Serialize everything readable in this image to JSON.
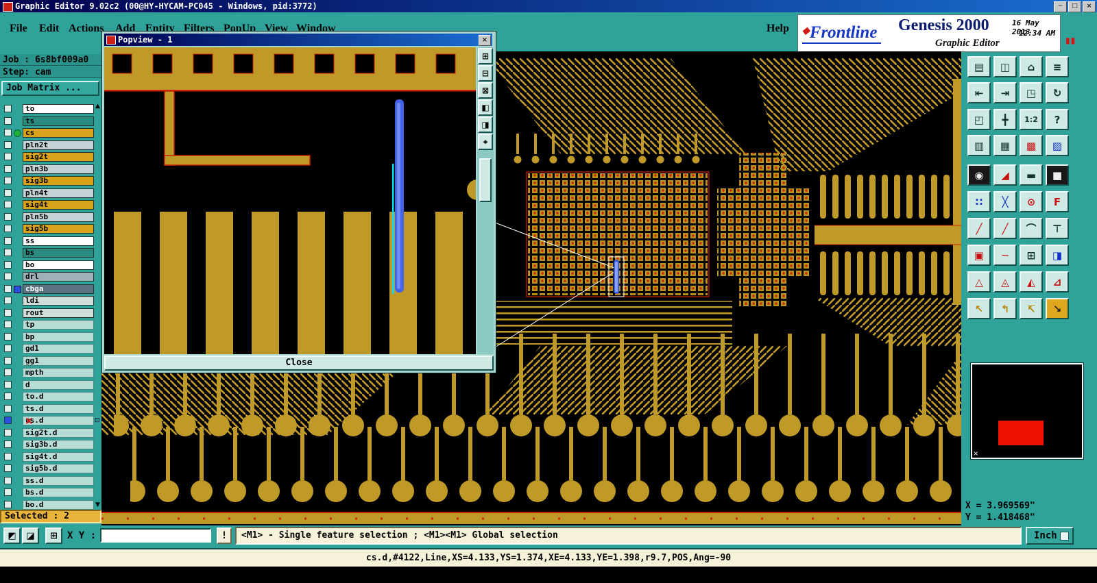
{
  "titlebar": {
    "title": "Graphic Editor 9.02c2 (00@HY-HYCAM-PC045 - Windows, pid:3772)"
  },
  "icons": {
    "minimize": "─",
    "maximize": "□",
    "close": "×",
    "scroll_up": "▲",
    "scroll_down": "▼",
    "red_x": "×",
    "pause": "▮▮",
    "logo_diamond": "◆",
    "grid_small": "⊡",
    "snap1": "◩",
    "snap2": "◪",
    "snap3": "⊞"
  },
  "menu": {
    "items": [
      "File",
      "Edit",
      "Actions",
      "Add",
      "Entity",
      "Filters",
      "PopUp",
      "View",
      "Window"
    ],
    "help": "Help"
  },
  "branding": {
    "logo": "Frontline",
    "product": "Genesis 2000",
    "subtitle": "Graphic Editor",
    "date": "16 May 2013",
    "time": "12:34 AM"
  },
  "job_panel": {
    "job": "Job : 6s8bf009a0",
    "step": "Step: cam",
    "matrix_button": "Job Matrix ..."
  },
  "layers": [
    "to",
    "ts",
    "cs",
    "pln2t",
    "sig2t",
    "pln3b",
    "sig3b",
    "pln4t",
    "sig4t",
    "pln5b",
    "sig5b",
    "ss",
    "bs",
    "bo",
    "drl",
    "cbga",
    "ldi",
    "rout",
    "tp",
    "bp",
    "gd1",
    "gg1",
    "mpth",
    "d",
    "to.d",
    "ts.d",
    "cs.d",
    "sig2t.d",
    "sig3b.d",
    "sig4t.d",
    "sig5b.d",
    "ss.d",
    "bs.d",
    "bo.d"
  ],
  "selected_bar": "Selected : 2",
  "toolbox": [
    "▤",
    "◫",
    "⌂",
    "≡",
    "⇤",
    "⇥",
    "◳",
    "↻",
    "◰",
    "╋",
    "1:2",
    "?",
    "▥",
    "▦",
    "▩",
    "▨",
    "◉",
    "◢",
    "▬",
    "■",
    "∷",
    "╳",
    "⊙",
    "F",
    "╱",
    "╱",
    "⌒",
    "⊤",
    "▣",
    "─",
    "⊞",
    "◨",
    "△",
    "◬",
    "◭",
    "⊿",
    "↖",
    "↰",
    "↸",
    "↘"
  ],
  "popview": {
    "title": "Popview - 1",
    "close_button": "Close",
    "tools": [
      "⊞",
      "⊟",
      "⊠",
      "◧",
      "◨",
      "⌖"
    ]
  },
  "coords": {
    "x": "X = 3.969569\"",
    "y": "Y = 1.418468\""
  },
  "bottom": {
    "xy_label": "X Y :",
    "input_value": "",
    "alert": "!",
    "message": "<M1> - Single feature selection ; <M1><M1> Global selection",
    "units": "Inch"
  },
  "statusbar": "cs.d,#4122,Line,XS=4.133,YS=1.374,XE=4.133,YE=1.398,r9.7,POS,Ang=-90"
}
